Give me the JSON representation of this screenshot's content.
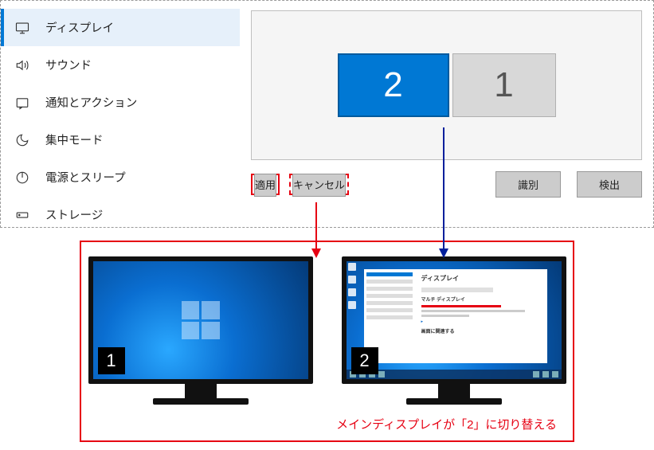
{
  "sidebar": {
    "items": [
      {
        "label": "ディスプレイ",
        "icon": "monitor-icon",
        "active": true
      },
      {
        "label": "サウンド",
        "icon": "sound-icon"
      },
      {
        "label": "通知とアクション",
        "icon": "notification-icon"
      },
      {
        "label": "集中モード",
        "icon": "focus-icon"
      },
      {
        "label": "電源とスリープ",
        "icon": "power-icon"
      },
      {
        "label": "ストレージ",
        "icon": "storage-icon"
      }
    ]
  },
  "arrange": {
    "display2": "2",
    "display1": "1"
  },
  "buttons": {
    "apply": "適用",
    "cancel": "キャンセル",
    "identify": "識別",
    "detect": "検出"
  },
  "result": {
    "badge1": "1",
    "badge2": "2",
    "caption": "メインディスプレイが「2」に切り替える",
    "mini": {
      "title": "ディスプレイ",
      "sub1": "マルチ ディスプレイ",
      "sub2": "画面に関連する"
    }
  }
}
